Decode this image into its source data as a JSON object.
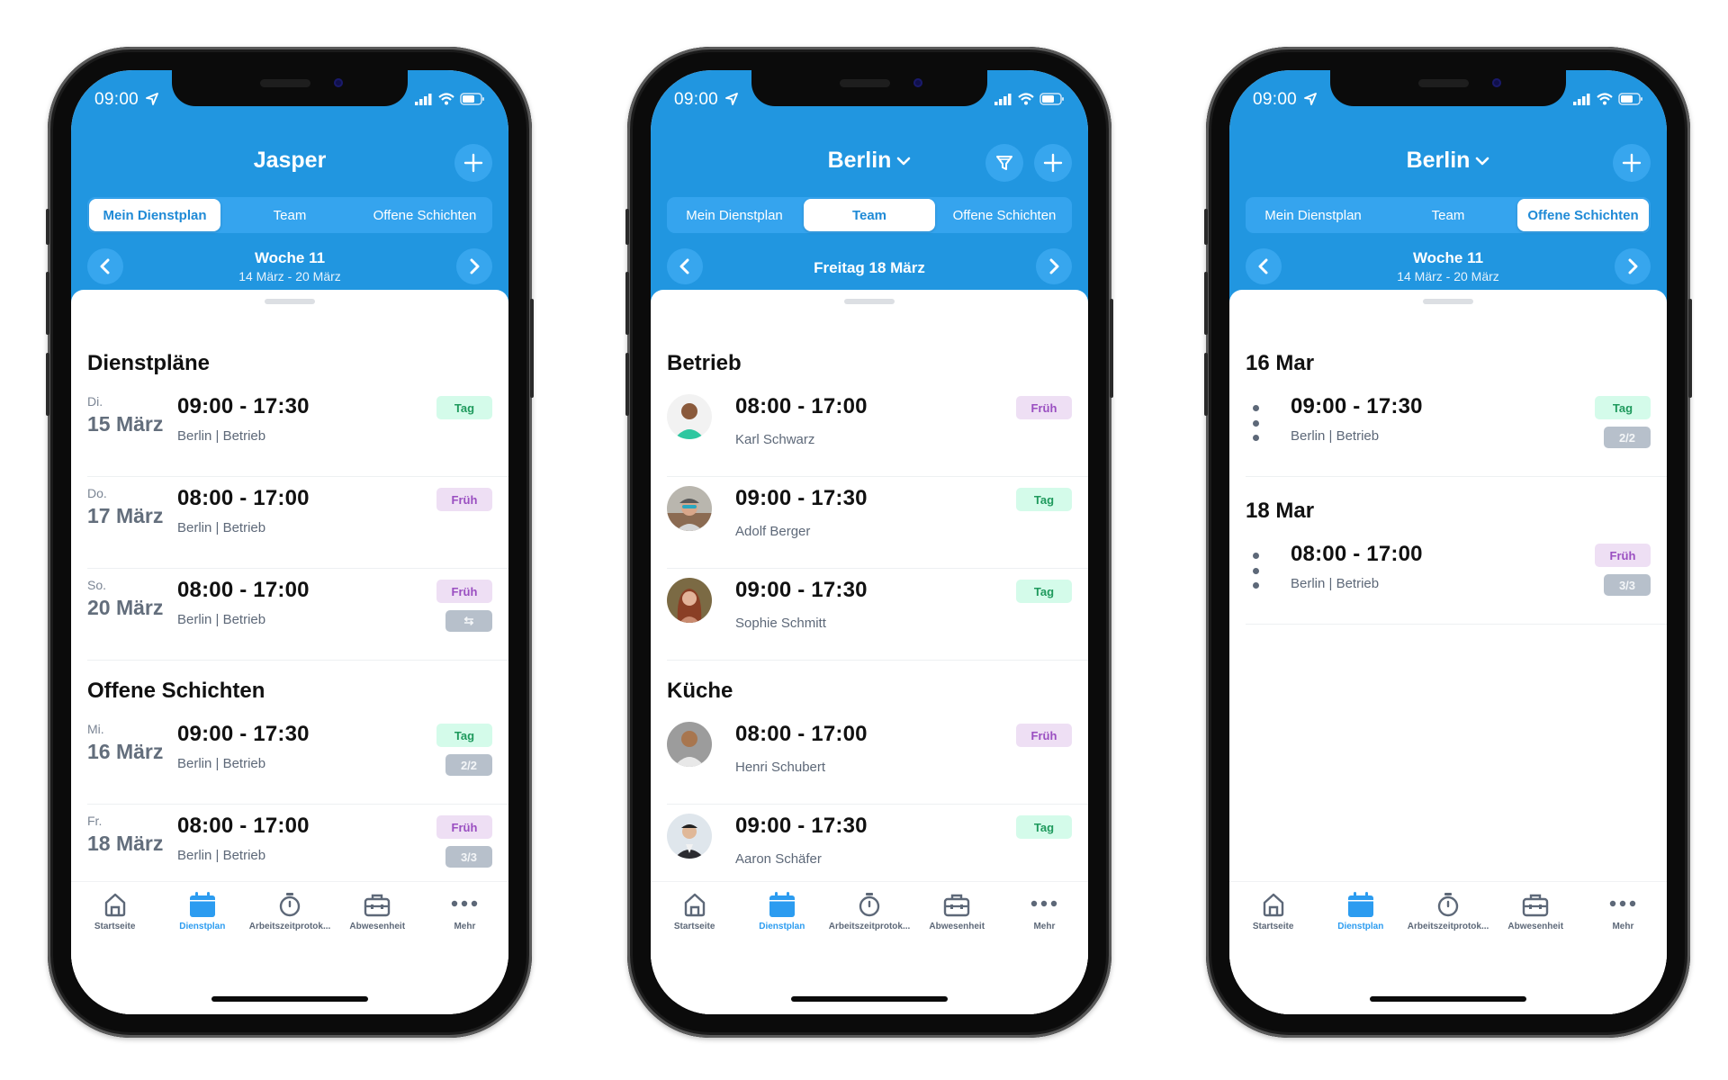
{
  "status_bar": {
    "time": "09:00"
  },
  "colors": {
    "brand_blue": "#2196e0",
    "tag_green": "#1f9a5d",
    "frueh_purple": "#9a4fc1",
    "active_tab": "#2c9cf0"
  },
  "segments": [
    "Mein Dienstplan",
    "Team",
    "Offene Schichten"
  ],
  "tabbar": [
    {
      "label": "Startseite",
      "icon": "home-icon"
    },
    {
      "label": "Dienstplan",
      "icon": "calendar-icon"
    },
    {
      "label": "Arbeitszeitprotok...",
      "icon": "stopwatch-icon"
    },
    {
      "label": "Abwesenheit",
      "icon": "briefcase-icon"
    },
    {
      "label": "Mehr",
      "icon": "more-icon"
    }
  ],
  "phones": [
    {
      "title": "Jasper",
      "active_segment": 0,
      "date_nav": {
        "main": "Woche 11",
        "sub": "14 März - 20 März"
      },
      "sections": [
        {
          "title": "Dienstpläne",
          "rows": [
            {
              "day_small": "Di.",
              "day_big": "15 März",
              "time": "09:00 - 17:30",
              "sub": "Berlin | Betrieb",
              "badge": "Tag"
            },
            {
              "day_small": "Do.",
              "day_big": "17 März",
              "time": "08:00 - 17:00",
              "sub": "Berlin | Betrieb",
              "badge": "Früh"
            },
            {
              "day_small": "So.",
              "day_big": "20 März",
              "time": "08:00 - 17:00",
              "sub": "Berlin | Betrieb",
              "badge": "Früh",
              "badge2": "⇆"
            }
          ]
        },
        {
          "title": "Offene Schichten",
          "rows": [
            {
              "day_small": "Mi.",
              "day_big": "16 März",
              "time": "09:00 - 17:30",
              "sub": "Berlin | Betrieb",
              "badge": "Tag",
              "badge2": "2/2"
            },
            {
              "day_small": "Fr.",
              "day_big": "18 März",
              "time": "08:00 - 17:00",
              "sub": "Berlin | Betrieb",
              "badge": "Früh",
              "badge2": "3/3"
            }
          ]
        }
      ]
    },
    {
      "title": "Berlin",
      "active_segment": 1,
      "date_nav": {
        "main": "Freitag 18 März"
      },
      "sections": [
        {
          "title": "Betrieb",
          "rows": [
            {
              "time": "08:00 - 17:00",
              "sub": "Karl Schwarz",
              "badge": "Früh"
            },
            {
              "time": "09:00 - 17:30",
              "sub": "Adolf Berger",
              "badge": "Tag"
            },
            {
              "time": "09:00 - 17:30",
              "sub": "Sophie Schmitt",
              "badge": "Tag"
            }
          ]
        },
        {
          "title": "Küche",
          "rows": [
            {
              "time": "08:00 - 17:00",
              "sub": "Henri Schubert",
              "badge": "Früh"
            },
            {
              "time": "09:00 - 17:30",
              "sub": "Aaron Schäfer",
              "badge": "Tag"
            }
          ]
        }
      ]
    },
    {
      "title": "Berlin",
      "active_segment": 2,
      "date_nav": {
        "main": "Woche 11",
        "sub": "14 März - 20 März"
      },
      "sections": [
        {
          "title": "16 Mar",
          "rows": [
            {
              "time": "09:00 - 17:30",
              "sub": "Berlin | Betrieb",
              "badge": "Tag",
              "badge2": "2/2"
            }
          ]
        },
        {
          "title": "18 Mar",
          "rows": [
            {
              "time": "08:00 - 17:00",
              "sub": "Berlin | Betrieb",
              "badge": "Früh",
              "badge2": "3/3"
            }
          ]
        }
      ]
    }
  ]
}
